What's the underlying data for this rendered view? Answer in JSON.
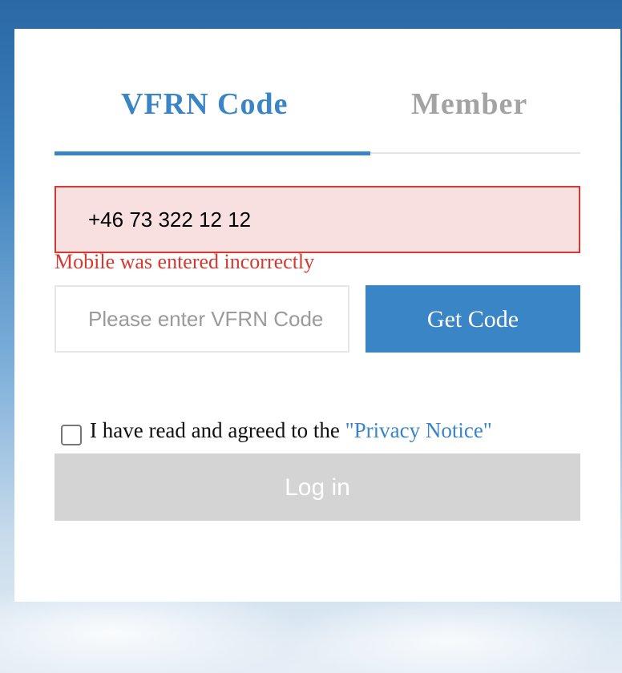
{
  "tabs": {
    "active_label": "VFRN Code",
    "inactive_label": "Member"
  },
  "form": {
    "mobile_value": "+46 73 322 12 12",
    "mobile_error": "Mobile was entered incorrectly",
    "code_placeholder": "Please enter VFRN Code",
    "get_code_label": "Get Code",
    "agree_text": "I have read and agreed to the",
    "privacy_link": "\"Privacy Notice\"",
    "agree_checked": false,
    "login_label": "Log in"
  },
  "colors": {
    "accent": "#3a85c6",
    "error": "#d8392f",
    "error_bg": "#f9e0e0",
    "disabled_button": "#d4d4d4"
  }
}
